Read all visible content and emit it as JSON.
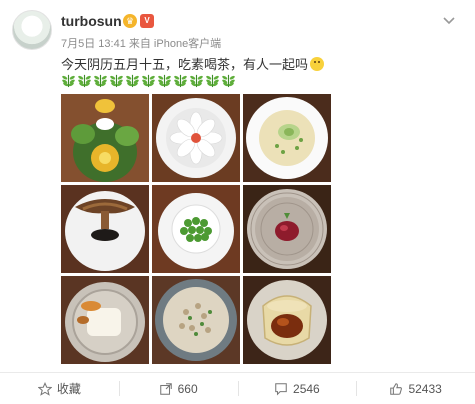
{
  "post": {
    "username": "turbosun",
    "meta": "7月5日 13:41 来自 iPhone客户端",
    "text": "今天阴历五月十五，吃素喝茶，有人一起吗",
    "leaf_emoji_count": 11,
    "badges": [
      "crown-icon",
      "vip-icon"
    ]
  },
  "photos": [
    {
      "name": "photo-vegetable-platter"
    },
    {
      "name": "photo-flower-carved-dish"
    },
    {
      "name": "photo-soup-bowl"
    },
    {
      "name": "photo-mushroom-plate"
    },
    {
      "name": "photo-green-peas"
    },
    {
      "name": "photo-red-dessert"
    },
    {
      "name": "photo-tofu-dish"
    },
    {
      "name": "photo-rice-bowl"
    },
    {
      "name": "photo-tea-jelly"
    }
  ],
  "actions": {
    "favorite_label": "收藏",
    "repost_count": "660",
    "comment_count": "2546",
    "like_count": "52433"
  },
  "colors": {
    "link": "#eb7350",
    "meta": "#8b8b8b",
    "text": "#333333"
  }
}
